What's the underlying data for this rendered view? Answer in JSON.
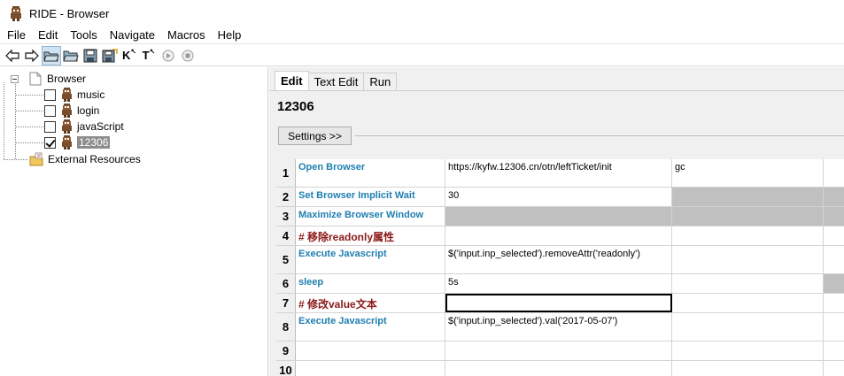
{
  "window": {
    "title": "RIDE - Browser"
  },
  "menu": [
    "File",
    "Edit",
    "Tools",
    "Navigate",
    "Macros",
    "Help"
  ],
  "toolbar": {
    "icons": [
      "back-arrow-icon",
      "forward-arrow-icon",
      "open-directory-icon",
      "open-folder-icon",
      "save-icon",
      "save-all-icon",
      "search-keywords-icon",
      "search-tests-icon",
      "run-icon",
      "stop-icon"
    ],
    "k_label": "K",
    "t_label": "T"
  },
  "tree": {
    "root": "Browser",
    "children": [
      {
        "label": "music",
        "checked": false
      },
      {
        "label": "login",
        "checked": false
      },
      {
        "label": "javaScript",
        "checked": false
      },
      {
        "label": "12306",
        "checked": true,
        "selected": true
      }
    ],
    "external": "External Resources"
  },
  "editor": {
    "tabs": [
      "Edit",
      "Text Edit",
      "Run"
    ],
    "active_tab": "Edit",
    "suite_title": "12306",
    "settings_button": "Settings >>",
    "rows": [
      {
        "num": "1",
        "c1": "Open Browser",
        "c2": "https://kyfw.12306.cn/otn/leftTicket/init",
        "c3": "gc",
        "type": "keyword"
      },
      {
        "num": "2",
        "c1": "Set Browser Implicit Wait",
        "c2": "30",
        "c3": "",
        "type": "keyword"
      },
      {
        "num": "3",
        "c1": "Maximize Browser Window",
        "c2": "",
        "c3": "",
        "type": "keyword"
      },
      {
        "num": "4",
        "c1": "# 移除readonly属性",
        "c2": "",
        "c3": "",
        "type": "comment"
      },
      {
        "num": "5",
        "c1": "Execute Javascript",
        "c2": "$('input.inp_selected').removeAttr('readonly')",
        "c3": "",
        "type": "keyword"
      },
      {
        "num": "6",
        "c1": "sleep",
        "c2": "5s",
        "c3": "",
        "type": "keyword"
      },
      {
        "num": "7",
        "c1": "# 修改value文本",
        "c2": "",
        "c3": "",
        "type": "comment"
      },
      {
        "num": "8",
        "c1": "Execute Javascript",
        "c2": "$('input.inp_selected').val('2017-05-07')",
        "c3": "",
        "type": "keyword"
      },
      {
        "num": "9",
        "c1": "",
        "c2": "",
        "c3": "",
        "type": "empty"
      },
      {
        "num": "10",
        "c1": "",
        "c2": "",
        "c3": "",
        "type": "empty"
      }
    ]
  },
  "colors": {
    "keyword": "#1f7fb0",
    "comment": "#8b1a1a",
    "disabled_cell": "#c0c0c0",
    "selected_node": "#8c8c8c"
  }
}
